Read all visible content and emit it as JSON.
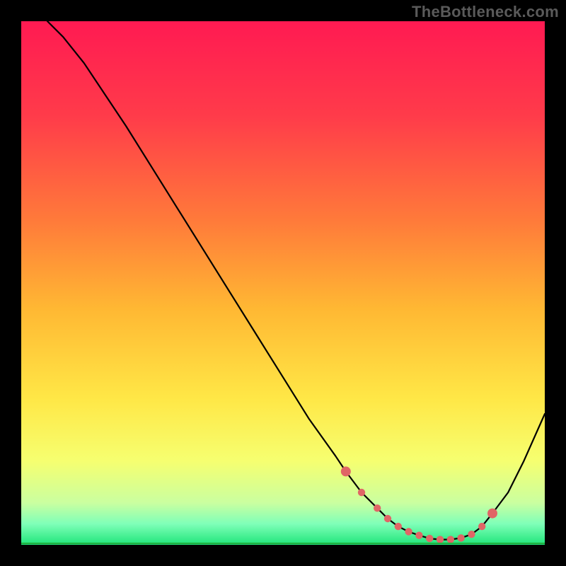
{
  "watermark": "TheBottleneck.com",
  "colors": {
    "gradient_top": "#ff1a52",
    "gradient_mid": "#ffe746",
    "gradient_bottom": "#1fe57a",
    "curve": "#000000",
    "marker": "#e06666",
    "baseline": "#1fae3e",
    "frame": "#000000"
  },
  "chart_data": {
    "type": "line",
    "title": "",
    "xlabel": "",
    "ylabel": "",
    "xlim": [
      0,
      100
    ],
    "ylim": [
      0,
      100
    ],
    "x": [
      5,
      8,
      12,
      16,
      20,
      25,
      30,
      35,
      40,
      45,
      50,
      55,
      60,
      62,
      65,
      68,
      70,
      72,
      74,
      76,
      78,
      80,
      82,
      84,
      86,
      88,
      90,
      93,
      96,
      100
    ],
    "values": [
      100,
      97,
      92,
      86,
      80,
      72,
      64,
      56,
      48,
      40,
      32,
      24,
      17,
      14,
      10,
      7,
      5,
      3.5,
      2.5,
      1.8,
      1.2,
      1,
      1,
      1.3,
      2,
      3.5,
      6,
      10,
      16,
      25
    ],
    "markers_x": [
      62,
      65,
      68,
      70,
      72,
      74,
      76,
      78,
      80,
      82,
      84,
      86,
      88,
      90
    ],
    "markers_y": [
      14,
      10,
      7,
      5,
      3.5,
      2.5,
      1.8,
      1.2,
      1,
      1,
      1.3,
      2,
      3.5,
      6
    ],
    "grid": false,
    "legend": false,
    "annotations": []
  }
}
